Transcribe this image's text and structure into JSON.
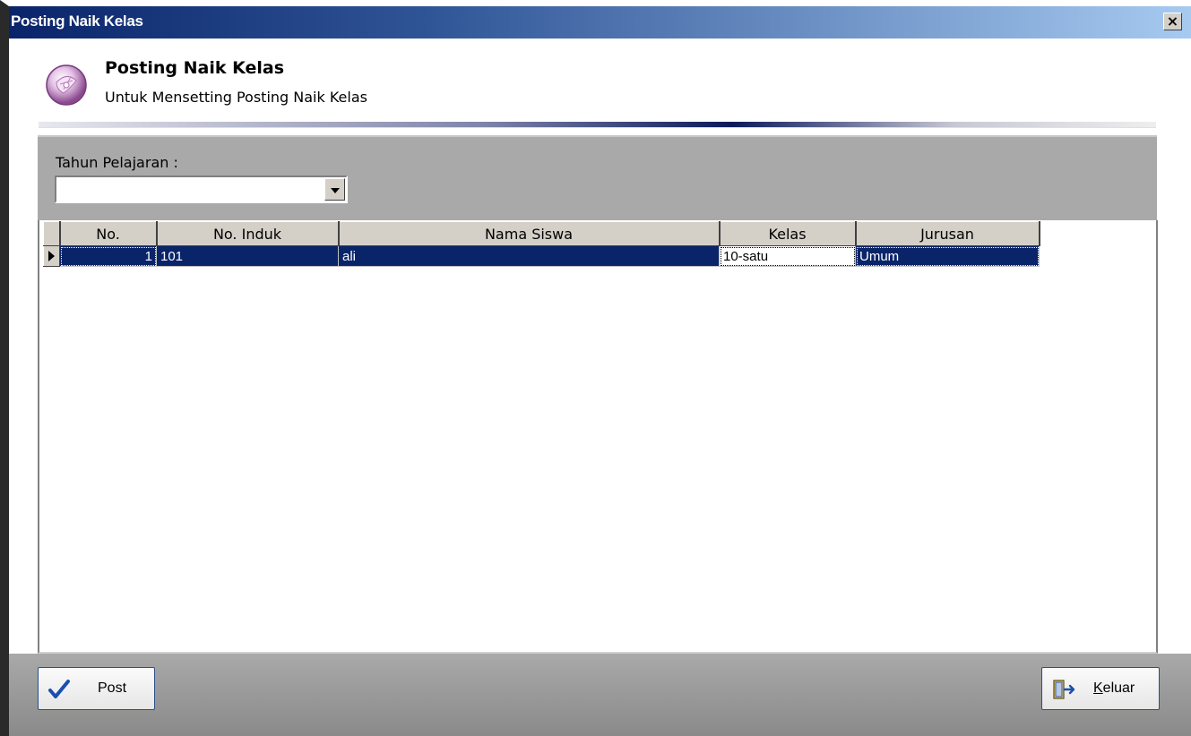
{
  "window": {
    "title": "Posting Naik Kelas",
    "close_glyph": "×"
  },
  "header": {
    "title": "Posting Naik Kelas",
    "subtitle": "Untuk Mensetting Posting Naik Kelas",
    "icon": "posting-logo-icon"
  },
  "filter": {
    "tahun_label": "Tahun Pelajaran :",
    "tahun_value": ""
  },
  "grid": {
    "columns": [
      "No.",
      "No. Induk",
      "Nama Siswa",
      "Kelas",
      "Jurusan"
    ],
    "rows": [
      {
        "no": "1",
        "no_induk": "101",
        "nama": "ali",
        "kelas": "10-satu",
        "jurusan": "Umum"
      }
    ]
  },
  "buttons": {
    "post_label": "Post",
    "keluar_first": "K",
    "keluar_rest": "eluar"
  },
  "colors": {
    "titlebar_start": "#0a246a",
    "selection": "#0a246a",
    "panel": "#a9a9a9"
  }
}
